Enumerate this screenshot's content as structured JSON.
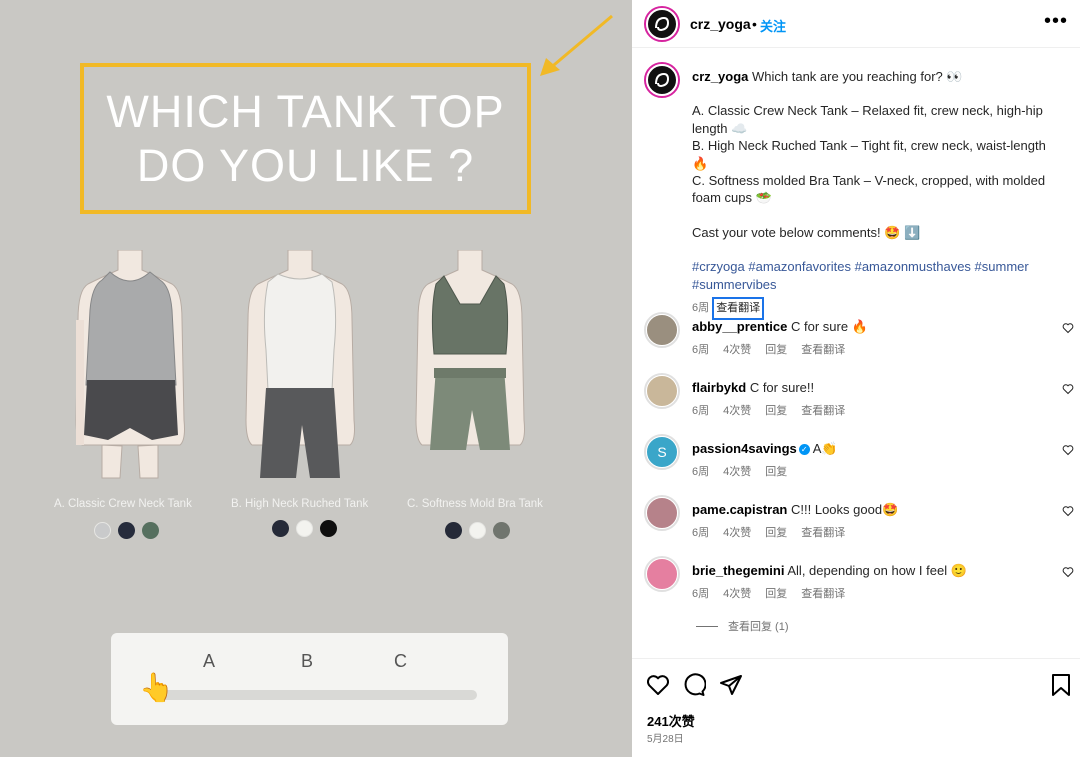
{
  "media": {
    "title_line1": "WHICH TANK TOP",
    "title_line2": "DO YOU LIKE ?",
    "accent_color": "#f1b926",
    "items": [
      {
        "caption": "A. Classic Crew Neck Tank",
        "swatches": [
          "#c9cacb",
          "#262c3c",
          "#56705f"
        ]
      },
      {
        "caption": "B. High Neck Ruched Tank",
        "swatches": [
          "#252a38",
          "#f3f3ef",
          "#0f0f0f"
        ]
      },
      {
        "caption": "C. Softness Mold Bra Tank",
        "swatches": [
          "#252a38",
          "#f3f3ef",
          "#70756e"
        ]
      }
    ],
    "vote": {
      "option_a": "A",
      "option_b": "B",
      "option_c": "C",
      "hand_icon": "pointing-hand-icon"
    }
  },
  "header": {
    "username": "crz_yoga",
    "dot": "•",
    "follow_label": "关注",
    "more_icon": "more-horizontal-icon"
  },
  "caption": {
    "username": "crz_yoga",
    "intro": "Which tank are you reaching for? 👀",
    "line_a": "A. Classic Crew Neck Tank – Relaxed fit, crew neck, high-hip length ☁️",
    "line_b": "B. High Neck Ruched Tank – Tight fit, crew neck, waist-length 🔥",
    "line_c": "C. Softness molded Bra Tank – V-neck, cropped, with molded foam cups 🥗",
    "cta": "Cast your vote below comments! 🤩 ⬇️",
    "hashtags": "#crzyoga #amazonfavorites #amazonmusthaves #summer #summervibes",
    "time": "6周",
    "translate_label": "查看翻译"
  },
  "comments": [
    {
      "username": "abby__prentice",
      "text": "C for sure 🔥",
      "time": "6周",
      "likes": "4次赞",
      "reply": "回复",
      "translate": "查看翻译",
      "verified": false
    },
    {
      "username": "flairbykd",
      "text": "C for sure!!",
      "time": "6周",
      "likes": "4次赞",
      "reply": "回复",
      "translate": "查看翻译",
      "verified": false
    },
    {
      "username": "passion4savings",
      "text": "A👏",
      "time": "6周",
      "likes": "4次赞",
      "reply": "回复",
      "translate": "",
      "verified": true
    },
    {
      "username": "pame.capistran",
      "text": "C!!! Looks good🤩",
      "time": "6周",
      "likes": "4次赞",
      "reply": "回复",
      "translate": "查看翻译",
      "verified": false
    },
    {
      "username": "brie_thegemini",
      "text": "All, depending on how I feel 🙂",
      "time": "6周",
      "likes": "4次赞",
      "reply": "回复",
      "translate": "查看翻译",
      "verified": false
    }
  ],
  "view_replies": "查看回复 (1)",
  "footer": {
    "likes": "241次赞",
    "date": "5月28日"
  }
}
